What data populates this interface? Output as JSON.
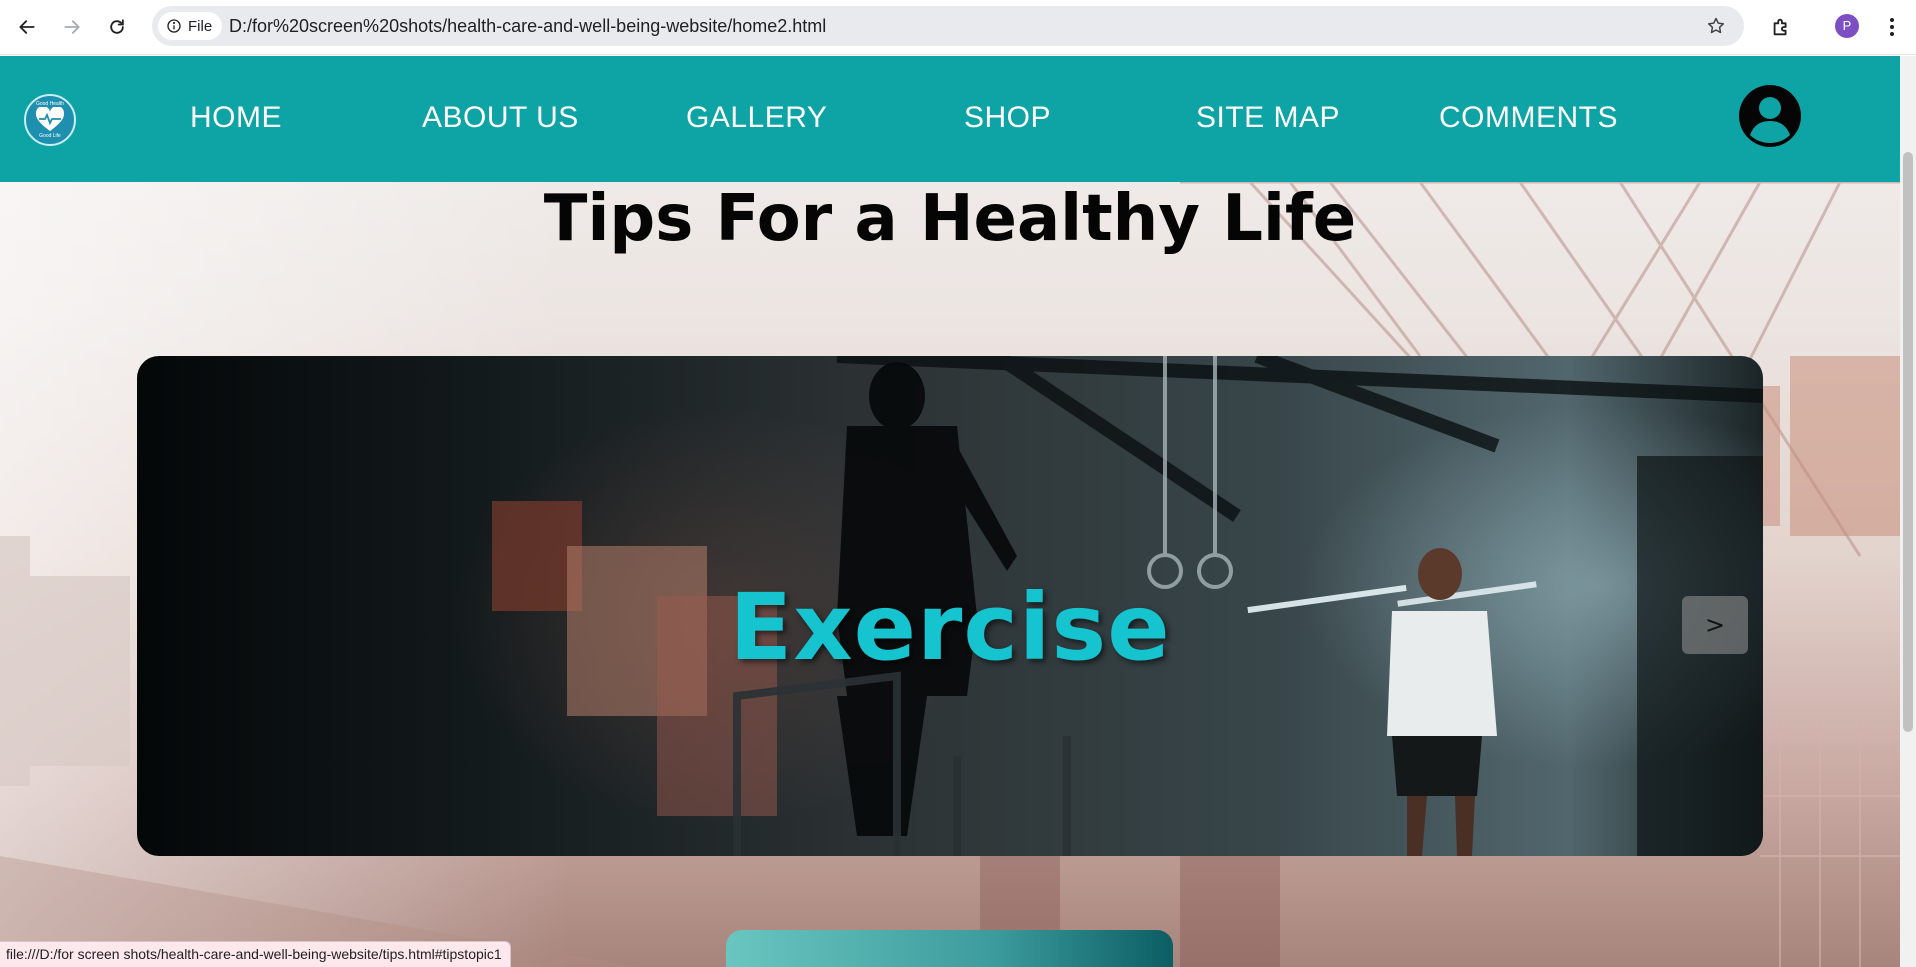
{
  "browser": {
    "file_chip_label": "File",
    "url": "D:/for%20screen%20shots/health-care-and-well-being-website/home2.html",
    "profile_initial": "P",
    "status_url": "file:///D:/for screen shots/health-care-and-well-being-website/tips.html#tipstopic1"
  },
  "site": {
    "logo_top_text": "Good Health",
    "logo_bottom_text": "Good Life",
    "nav": [
      "HOME",
      "ABOUT US",
      "GALLERY",
      "SHOP",
      "SITE MAP",
      "COMMENTS"
    ],
    "header_color": "#0ea3a5"
  },
  "main": {
    "title": "Tips For a Healthy Life",
    "slide": {
      "title": "Exercise",
      "title_color": "#15c4cf",
      "next_label": ">"
    }
  },
  "icons": {
    "back": "back-arrow-icon",
    "forward": "forward-arrow-icon",
    "reload": "reload-icon",
    "info": "info-icon",
    "bookmark": "star-icon",
    "extensions": "puzzle-icon",
    "menu": "kebab-menu-icon",
    "user": "user-account-icon"
  }
}
